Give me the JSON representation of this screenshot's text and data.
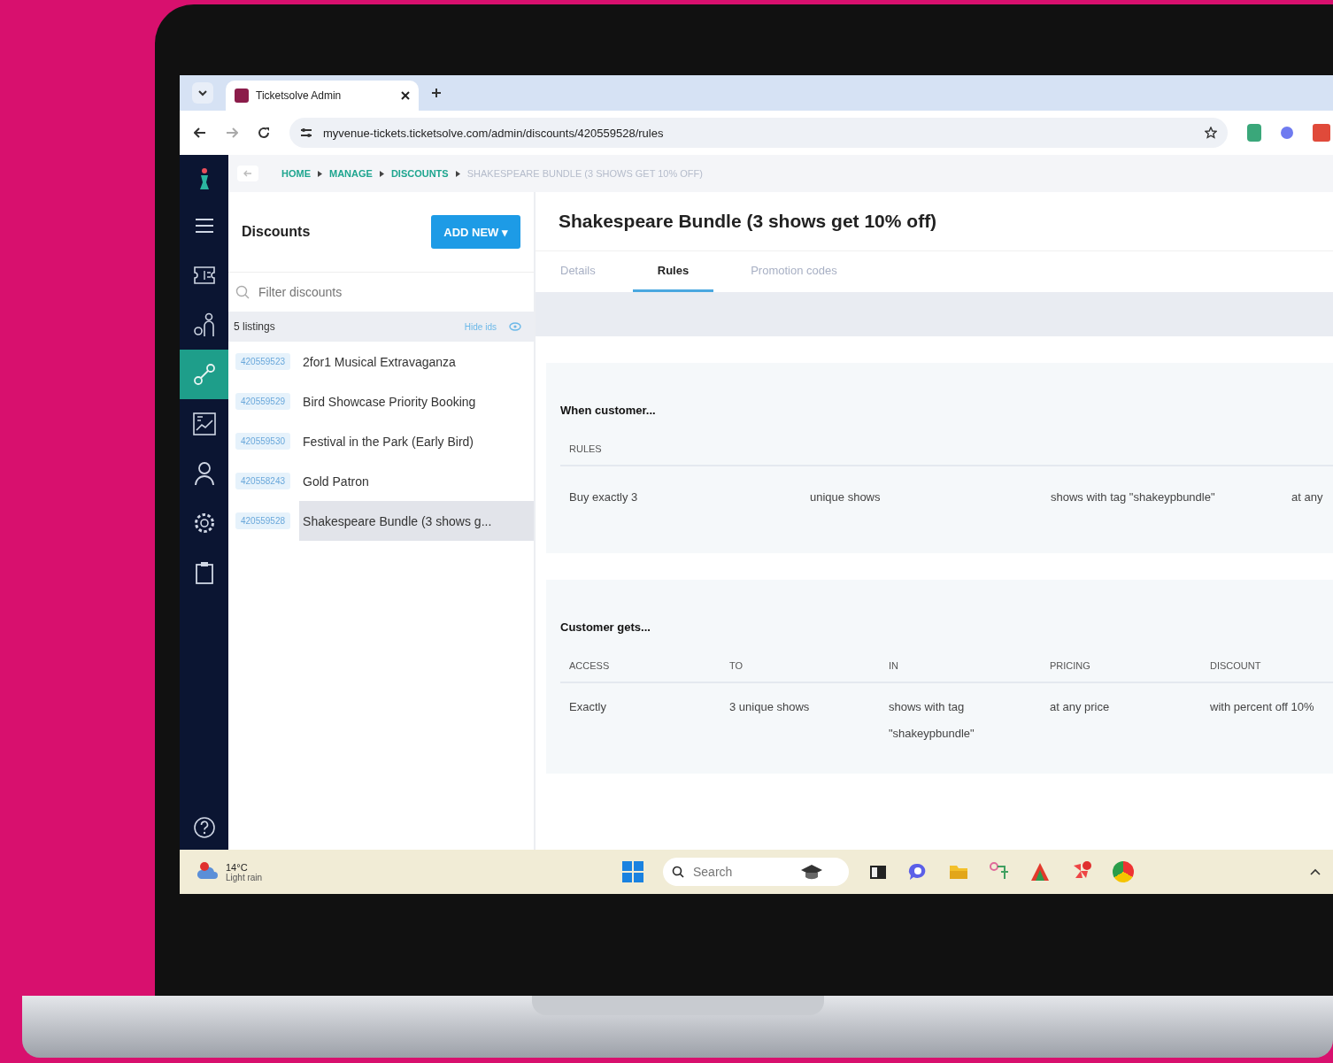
{
  "browser": {
    "tab_title": "Ticketsolve Admin",
    "url": "myvenue-tickets.ticketsolve.com/admin/discounts/420559528/rules"
  },
  "breadcrumb": [
    {
      "label": "HOME",
      "kind": "link"
    },
    {
      "label": "MANAGE",
      "kind": "link"
    },
    {
      "label": "DISCOUNTS",
      "kind": "link"
    },
    {
      "label": "SHAKESPEARE BUNDLE (3 SHOWS GET 10% OFF)",
      "kind": "current"
    }
  ],
  "nav_items": [
    {
      "kind": "menu",
      "selected": false
    },
    {
      "kind": "ticket",
      "selected": false
    },
    {
      "kind": "people",
      "selected": false
    },
    {
      "kind": "link",
      "selected": true
    },
    {
      "kind": "chart",
      "selected": false
    },
    {
      "kind": "person",
      "selected": false
    },
    {
      "kind": "gear",
      "selected": false
    },
    {
      "kind": "clipboard",
      "selected": false
    }
  ],
  "list_panel": {
    "title": "Discounts",
    "add_button": "ADD NEW ▾",
    "filter": {
      "placeholder": "Filter discounts"
    },
    "count": "5 listings",
    "hide_ids": "Hide ids",
    "items": [
      {
        "id": "420559523",
        "name": "2for1 Musical Extravaganza",
        "selected": false
      },
      {
        "id": "420559529",
        "name": "Bird Showcase Priority Booking",
        "selected": false
      },
      {
        "id": "420559530",
        "name": "Festival in the Park (Early Bird)",
        "selected": false
      },
      {
        "id": "420558243",
        "name": "Gold Patron",
        "selected": false
      },
      {
        "id": "420559528",
        "name": "Shakespeare Bundle (3 shows g...",
        "selected": true
      }
    ]
  },
  "detail": {
    "title": "Shakespeare Bundle (3 shows get 10% off)",
    "tabs": [
      {
        "label": "Details",
        "selected": false
      },
      {
        "label": "Rules",
        "selected": true
      },
      {
        "label": "Promotion codes",
        "selected": false
      }
    ],
    "when": {
      "heading": "When customer...",
      "columns": [
        "RULES"
      ],
      "row": [
        "Buy exactly 3",
        "unique shows",
        "shows with tag \"shakeypbundle\"",
        "at any"
      ]
    },
    "gets": {
      "heading": "Customer gets...",
      "columns": [
        "ACCESS",
        "TO",
        "IN",
        "PRICING",
        "DISCOUNT"
      ],
      "row": [
        "Exactly",
        "3 unique shows",
        "shows with tag \"shakeypbundle\"",
        "at any price",
        "with percent off 10%"
      ]
    }
  },
  "taskbar": {
    "temperature": "14°C",
    "weather": "Light rain",
    "search": {
      "placeholder": "Search"
    }
  }
}
